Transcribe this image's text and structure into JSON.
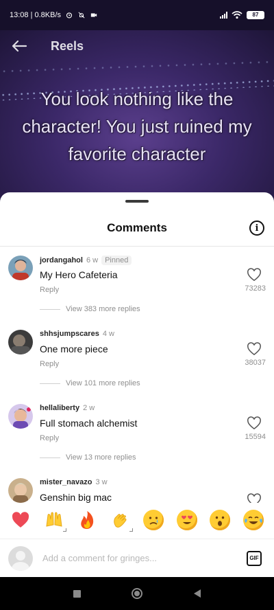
{
  "status_bar": {
    "time_speed": "13:08 | 0.8KB/s",
    "battery": "87"
  },
  "header": {
    "title": "Reels",
    "back_icon": "arrow-left-icon"
  },
  "video": {
    "caption": "You look nothing like the character! You just ruined my favorite character"
  },
  "comments_sheet": {
    "title": "Comments",
    "info_icon": "info-icon",
    "comments": [
      {
        "user": "jordangahol",
        "time": "6 w",
        "pinned": "Pinned",
        "text": "My Hero Cafeteria",
        "reply": "Reply",
        "likes": "73283",
        "view_replies": "View 383 more replies"
      },
      {
        "user": "shhsjumpscares",
        "time": "4 w",
        "pinned": "",
        "text": "One more piece",
        "reply": "Reply",
        "likes": "38037",
        "view_replies": "View 101 more replies"
      },
      {
        "user": "hellaliberty",
        "time": "2 w",
        "pinned": "",
        "text": "Full stomach alchemist",
        "reply": "Reply",
        "likes": "15594",
        "view_replies": "View 13 more replies"
      },
      {
        "user": "mister_navazo",
        "time": "3 w",
        "pinned": "",
        "text": "Genshin big mac",
        "reply": "",
        "likes": "",
        "view_replies": ""
      }
    ],
    "emoji_bar": [
      "❤",
      "🙌",
      "🔥",
      "👏",
      "😢",
      "😍",
      "😮",
      "😂"
    ],
    "input": {
      "placeholder": "Add a comment for gringes...",
      "gif_label": "GIF"
    }
  },
  "colors": {
    "accent": "#ed4956",
    "sheet_bg": "#ffffff",
    "video_bg": "#3b2868"
  }
}
